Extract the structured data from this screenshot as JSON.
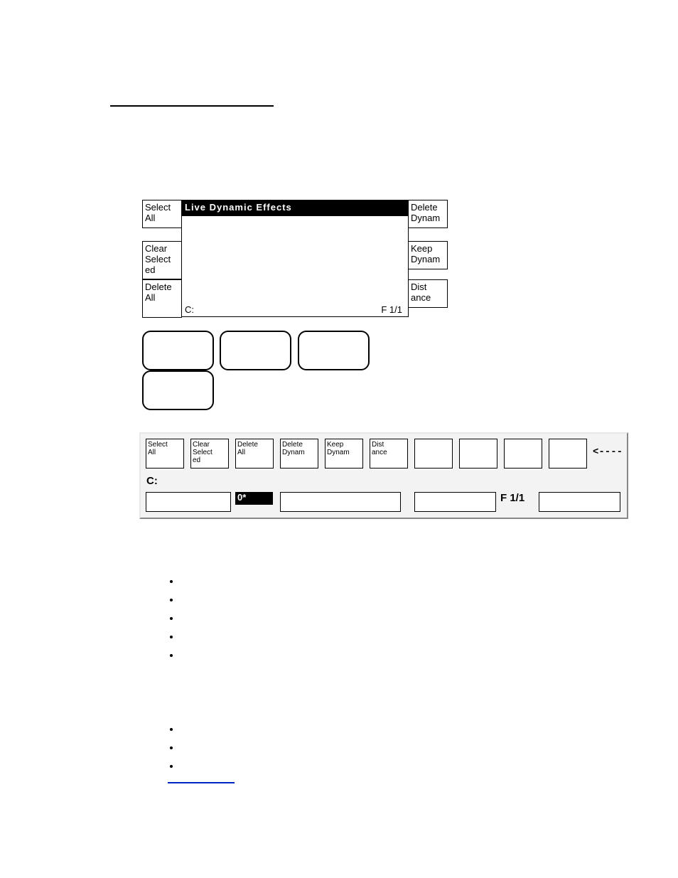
{
  "panel1": {
    "left_buttons": [
      "Select\nAll",
      "Clear\nSelect\ned",
      "Delete\nAll"
    ],
    "right_buttons": [
      "Delete\nDynam",
      "Keep\nDynam",
      "Dist\nance"
    ],
    "title": "Live   Dynamic   Effects",
    "status_left": "C:",
    "status_right": "F  1/1"
  },
  "panel2": {
    "buttons": [
      "Select\nAll",
      "Clear\nSelect\ned",
      "Delete\nAll",
      "Delete\nDynam",
      "Keep\nDynam",
      "Dist\nance",
      "",
      "",
      "",
      ""
    ],
    "arrow": "<----",
    "status_left": "C:",
    "zero_label": "0*",
    "page_label": "F 1/1"
  },
  "lists": {
    "a": [
      "",
      "",
      "",
      "",
      ""
    ],
    "b": [
      "",
      "",
      ""
    ]
  }
}
